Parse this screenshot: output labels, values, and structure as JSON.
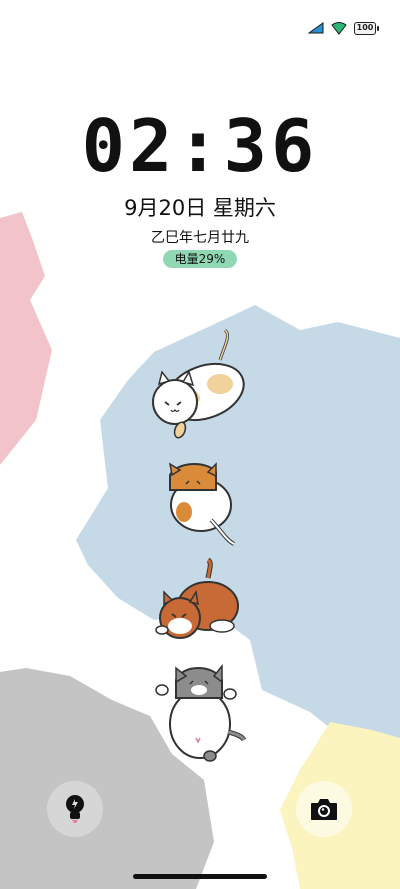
{
  "status_bar": {
    "signal_icon": "cellular-signal-icon",
    "wifi_icon": "wifi-icon",
    "battery_level": "100",
    "colors": {
      "signal": "#2a8fd6",
      "wifi": "#2bb673"
    }
  },
  "lock_screen": {
    "time": "02:36",
    "date": "9月20日 星期六",
    "lunar_date": "乙巳年七月廿九",
    "charging_status": "电量29%"
  },
  "shortcuts": {
    "left_icon": "flashlight-icon",
    "right_icon": "camera-icon"
  },
  "wallpaper": {
    "description_icons": [
      "cat-icon",
      "cat-icon",
      "cat-icon",
      "cat-icon"
    ],
    "colors": {
      "pink": "#f2c4c9",
      "blue": "#c6d9e6",
      "gray": "#c4c4c4",
      "yellow": "#fbf4bf",
      "charge_pill": "#8fd8b3"
    }
  }
}
